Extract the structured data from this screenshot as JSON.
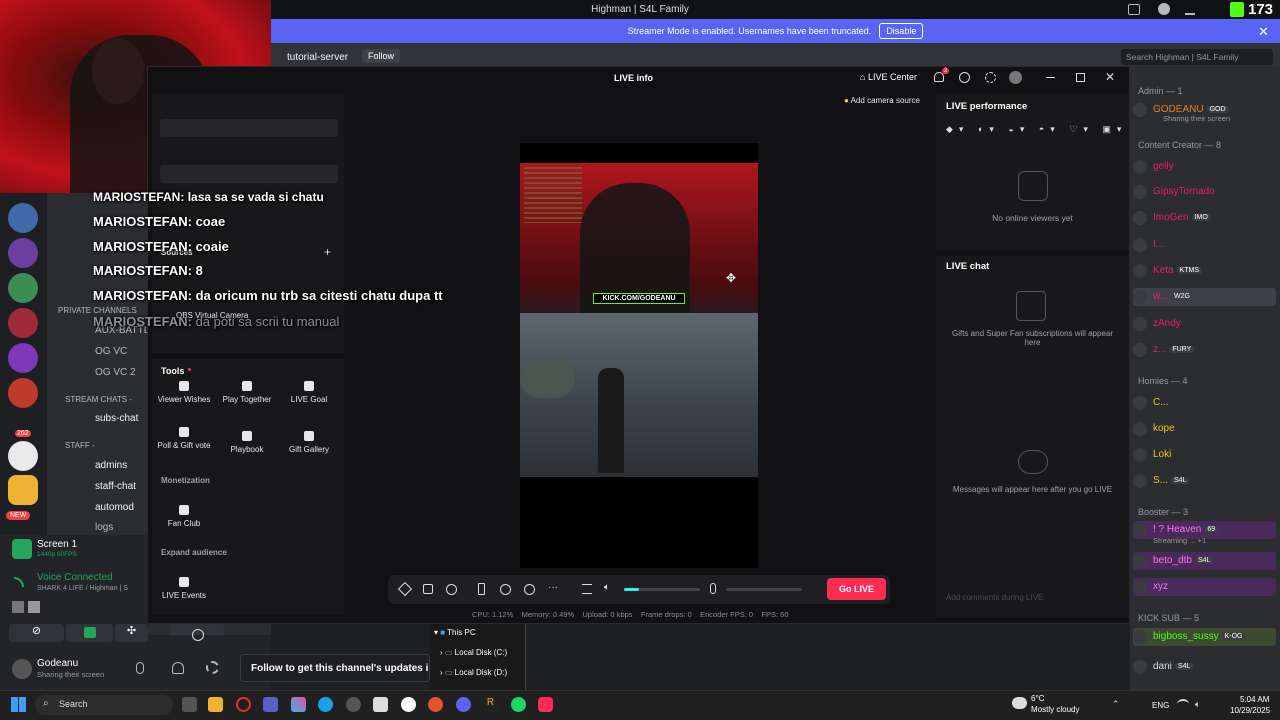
{
  "window": {
    "title": "Highman | S4L Family",
    "kick_count": "173"
  },
  "banner": {
    "text": "Streamer Mode is enabled. Usernames have been truncated.",
    "disable_label": "Disable"
  },
  "channel_header": {
    "name": "tutorial-server",
    "follow": "Follow",
    "search_placeholder": "Search Highman | S4L Family"
  },
  "tiktok": {
    "tab_title": "LIVE info",
    "live_center": "LIVE Center",
    "notif_badge": "2",
    "add_camera": "Add camera source",
    "sources_label": "Sources",
    "obs_camera": "OBS Virtual Camera",
    "tools_label": "Tools",
    "tools": [
      {
        "label": "Viewer Wishes"
      },
      {
        "label": "Play Together"
      },
      {
        "label": "LIVE Goal"
      },
      {
        "label": "Poll & Gift vote"
      },
      {
        "label": "Playbook"
      },
      {
        "label": "Gift Gallery"
      }
    ],
    "monetization_label": "Monetization",
    "fan_club": "Fan Club",
    "expand_label": "Expand audience",
    "live_events": "LIVE Events",
    "kick_tag": "KICK.COM/GODEANU",
    "go_live": "Go LIVE",
    "stats": [
      "CPU: 1.12%",
      "Memory: 0.49%",
      "Upload: 0 kbps",
      "Frame drops: 0",
      "Encoder FPS: 0",
      "FPS: 60"
    ],
    "performance_title": "LIVE performance",
    "no_viewers": "No online viewers yet",
    "chat_title": "LIVE chat",
    "gifts_text": "Gifts and Super Fan subscriptions will appear here",
    "messages_text": "Messages will appear here after you go LIVE",
    "comment_placeholder": "Add comments during LIVE"
  },
  "overlay_chat": [
    {
      "user": "MARIOSTEFAN:",
      "msg": "lasa sa se vada si chatu"
    },
    {
      "user": "MARIOSTEFAN:",
      "msg": "coae"
    },
    {
      "user": "MARIOSTEFAN:",
      "msg": "coaie"
    },
    {
      "user": "MARIOSTEFAN:",
      "msg": "8"
    },
    {
      "user": "MARIOSTEFAN:",
      "msg": "da oricum nu trb sa citesti chatu dupa tt"
    },
    {
      "user": "MARIOSTEFAN:",
      "msg": "da poti sa scrii tu manual"
    }
  ],
  "channels": [
    {
      "name": "PRIVATE CHANNELS"
    },
    {
      "name": "AUX-BATTL"
    },
    {
      "name": "OG VC"
    },
    {
      "name": "OG VC 2"
    },
    {
      "name": "STREAM CHATS -"
    },
    {
      "name": "subs-chat"
    },
    {
      "name": "STAFF -"
    },
    {
      "name": "admins"
    },
    {
      "name": "staff-chat"
    },
    {
      "name": "automod"
    },
    {
      "name": "logs"
    }
  ],
  "server_badges": {
    "b1": "368",
    "b2": "262",
    "new": "NEW"
  },
  "screen": {
    "title": "Screen 1",
    "sub": "1440p 60FPS"
  },
  "voice": {
    "status": "Voice Connected",
    "server": "SHARK 4 LIFE / Highman | S"
  },
  "user": {
    "name": "Godeanu",
    "status": "Sharing their screen"
  },
  "follow_bar": "Follow to get this channel's updates in yo",
  "explorer": {
    "root": "This PC",
    "items": [
      "Local Disk (C:)",
      "Local Disk (D:)"
    ]
  },
  "members": [
    {
      "type": "hdr",
      "text": "Admin — 1"
    },
    {
      "name": "GODEANU",
      "tag": "GOD",
      "sub": "Sharing their screen",
      "color": "#e67e22"
    },
    {
      "type": "hdr",
      "text": "Content Creator — 8"
    },
    {
      "name": "gelly",
      "color": "#e91e63"
    },
    {
      "name": "GipsyTornado",
      "color": "#e91e63"
    },
    {
      "name": "ImoGen",
      "tag": "IMO",
      "color": "#e91e63"
    },
    {
      "name": "I...",
      "color": "#e91e63"
    },
    {
      "name": "Keta",
      "tag": "KTMS",
      "color": "#e91e63"
    },
    {
      "name": "w...",
      "tag": "W2G",
      "color": "#e91e63"
    },
    {
      "name": "zAndy",
      "color": "#e91e63"
    },
    {
      "name": "z...",
      "tag": "FURY",
      "color": "#e91e63"
    },
    {
      "type": "hdr",
      "text": "Homies — 4"
    },
    {
      "name": "C...",
      "color": "#f1c40f"
    },
    {
      "name": "kope",
      "color": "#f1c40f"
    },
    {
      "name": "Loki",
      "color": "#f1c40f"
    },
    {
      "name": "S...",
      "tag": "S4L",
      "color": "#f1c40f"
    },
    {
      "type": "hdr",
      "text": "Booster — 3"
    },
    {
      "name": "! ? Heaven",
      "tag": "69",
      "sub": "Streaming ... +1",
      "color": "#ff73fa"
    },
    {
      "name": "beto_dtb",
      "tag": "S4L",
      "color": "#ff73fa"
    },
    {
      "name": "xyz",
      "color": "#ff73fa"
    },
    {
      "type": "hdr",
      "text": "KICK SUB — 5"
    },
    {
      "name": "bigboss_sussy",
      "tag": "K-OG",
      "color": "#53fc18"
    },
    {
      "name": "dani",
      "tag": "S4L",
      "color": "#dbdee1"
    }
  ],
  "taskbar": {
    "search": "Search",
    "weather_temp": "6°C",
    "weather": "Mostly cloudy",
    "lang": "ENG",
    "time": "5:04 AM",
    "date": "10/29/2025"
  }
}
